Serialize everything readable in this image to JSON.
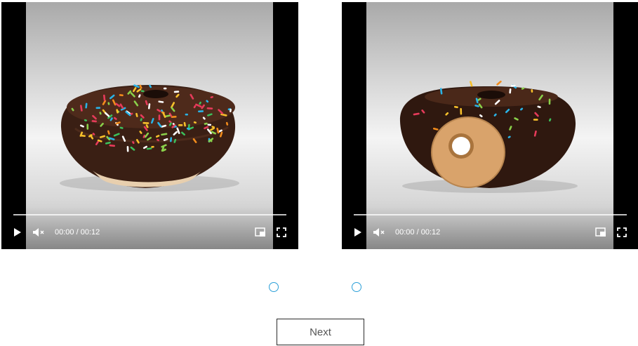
{
  "videos": [
    {
      "time": "00:00 / 00:12",
      "progress_fraction": 0,
      "controls": {
        "play": "play-icon",
        "mute": "muted-speaker-icon",
        "pip": "picture-in-picture-icon",
        "fullscreen": "fullscreen-icon"
      }
    },
    {
      "time": "00:00 / 00:12",
      "progress_fraction": 0,
      "controls": {
        "play": "play-icon",
        "mute": "muted-speaker-icon",
        "pip": "picture-in-picture-icon",
        "fullscreen": "fullscreen-icon"
      }
    }
  ],
  "choices": [
    {
      "checked": false
    },
    {
      "checked": false
    }
  ],
  "next_button": {
    "label": "Next"
  },
  "colors": {
    "radio_border": "#2a9fd8",
    "glaze": "#3a1f14",
    "dough": "#d9a36b",
    "sprinkle_palette": [
      "#f7c02b",
      "#2ab3e6",
      "#e63b5a",
      "#ffffff",
      "#3cbf5b",
      "#f28c1c",
      "#8ad04a"
    ]
  }
}
